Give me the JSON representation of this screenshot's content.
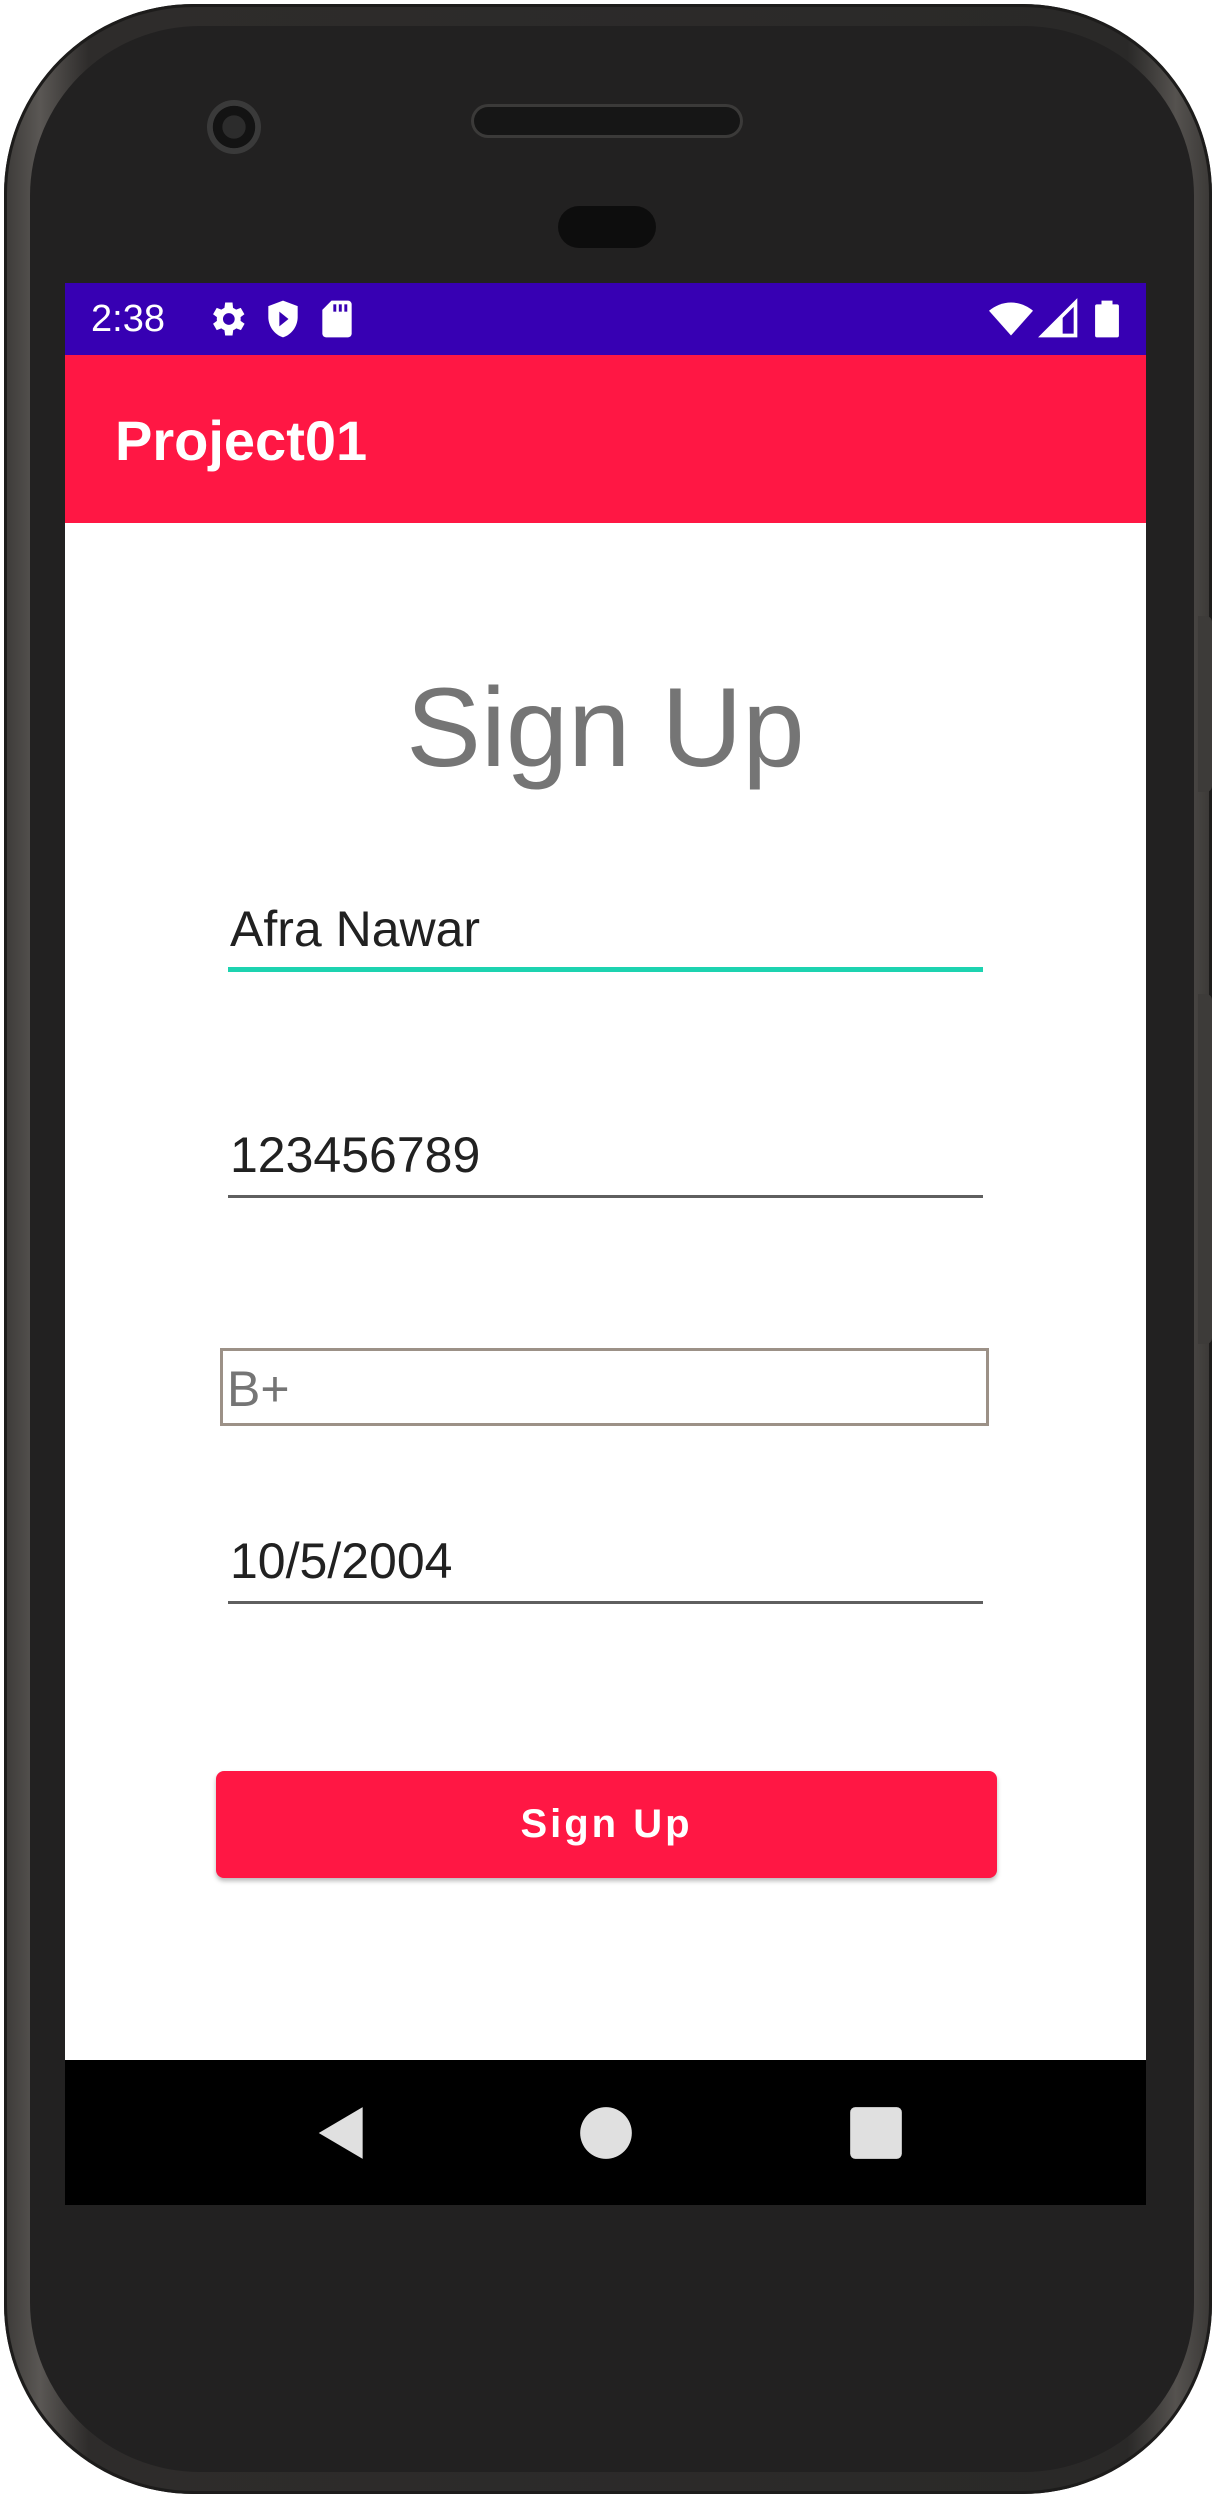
{
  "status_bar": {
    "time": "2:38",
    "left_icons": [
      "gear-icon",
      "shield-icon",
      "sd-card-icon"
    ],
    "right_icons": [
      "wifi-icon",
      "cell-signal-icon",
      "battery-icon"
    ],
    "background": "#3700b3"
  },
  "app_bar": {
    "title": "Project01",
    "background": "#ff1744"
  },
  "form": {
    "title": "Sign Up",
    "name_value": "Afra Nawar",
    "phone_value": "123456789",
    "blood_group_value": "B+",
    "dob_value": "10/5/2004",
    "submit_label": "Sign Up",
    "focus_color": "#1dd3b0"
  },
  "nav_bar": {
    "buttons": [
      "back-icon",
      "home-icon",
      "recents-icon"
    ]
  }
}
